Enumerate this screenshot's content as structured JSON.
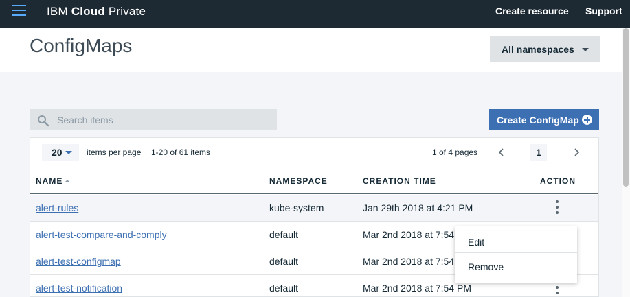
{
  "topbar": {
    "brand_prefix": "IBM ",
    "brand_bold": "Cloud",
    "brand_suffix": " Private",
    "create_resource": "Create resource",
    "support": "Support",
    "bg_color": "#1e2a33",
    "menu_icon": "hamburger-menu-icon"
  },
  "header": {
    "title": "ConfigMaps",
    "namespace_select": "All namespaces"
  },
  "toolbar": {
    "search_placeholder": "Search items",
    "create_button": "Create ConfigMap",
    "accent_color": "#3d70b2"
  },
  "pagination": {
    "per_page": "20",
    "per_page_label": "items per page",
    "range": "1-20 of 61 items",
    "page_info": "1 of 4 pages",
    "current_page": "1"
  },
  "table": {
    "columns": [
      "NAME",
      "NAMESPACE",
      "CREATION TIME",
      "ACTION"
    ],
    "rows": [
      {
        "name": "alert-rules",
        "namespace": "kube-system",
        "created": "Jan 29th 2018 at 4:21 PM"
      },
      {
        "name": "alert-test-compare-and-comply",
        "namespace": "default",
        "created": "Mar 2nd 2018 at 7:54 PM"
      },
      {
        "name": "alert-test-configmap",
        "namespace": "default",
        "created": "Mar 2nd 2018 at 7:54 PM"
      },
      {
        "name": "alert-test-notification",
        "namespace": "default",
        "created": "Mar 2nd 2018 at 7:54 PM"
      }
    ]
  },
  "action_menu": {
    "edit": "Edit",
    "remove": "Remove"
  }
}
